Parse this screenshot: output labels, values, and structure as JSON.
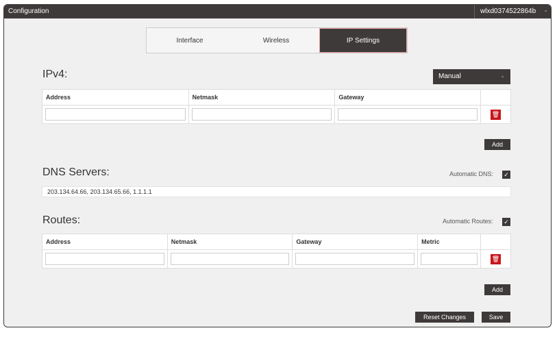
{
  "header": {
    "title": "Configuration",
    "device": "wlxd0374522864b"
  },
  "tabs": [
    {
      "label": "Interface"
    },
    {
      "label": "Wireless"
    },
    {
      "label": "IP Settings",
      "active": true
    }
  ],
  "ipv4": {
    "title": "IPv4:",
    "mode": "Manual",
    "columns": [
      "Address",
      "Netmask",
      "Gateway"
    ],
    "rows": [
      {
        "address": "",
        "netmask": "",
        "gateway": ""
      }
    ],
    "add_label": "Add"
  },
  "dns": {
    "title": "DNS Servers:",
    "auto_label": "Automatic DNS:",
    "auto_checked": true,
    "value": "203.134.64.66, 203.134.65.66, 1.1.1.1"
  },
  "routes": {
    "title": "Routes:",
    "auto_label": "Automatic Routes:",
    "auto_checked": true,
    "columns": [
      "Address",
      "Netmask",
      "Gateway",
      "Metric"
    ],
    "rows": [
      {
        "address": "",
        "netmask": "",
        "gateway": "",
        "metric": ""
      }
    ],
    "add_label": "Add"
  },
  "footer": {
    "reset_label": "Reset Changes",
    "save_label": "Save"
  },
  "colors": {
    "dark": "#3e3a39",
    "delete": "#c8161d"
  }
}
